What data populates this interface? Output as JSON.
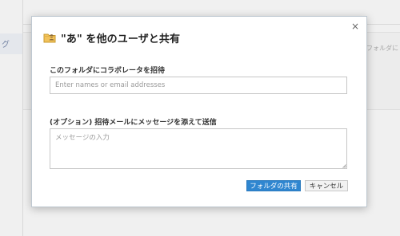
{
  "background": {
    "left_glyph": "グ",
    "right_text": "フォルダに"
  },
  "dialog": {
    "title": "\"あ\" を他のユーザと共有",
    "close_glyph": "×",
    "collaborator_label": "このフォルダにコラボレータを招待",
    "collaborator_placeholder": "Enter names or email addresses",
    "message_label": "(オプション) 招待メールにメッセージを添えて送信",
    "message_placeholder": "メッセージの入力",
    "share_button": "フォルダの共有",
    "cancel_button": "キャンセル"
  },
  "colors": {
    "primary": "#2f86d0",
    "border": "#c6c6c6"
  },
  "icons": {
    "title_icon": "shared-folder-icon",
    "close_icon": "close-icon"
  }
}
